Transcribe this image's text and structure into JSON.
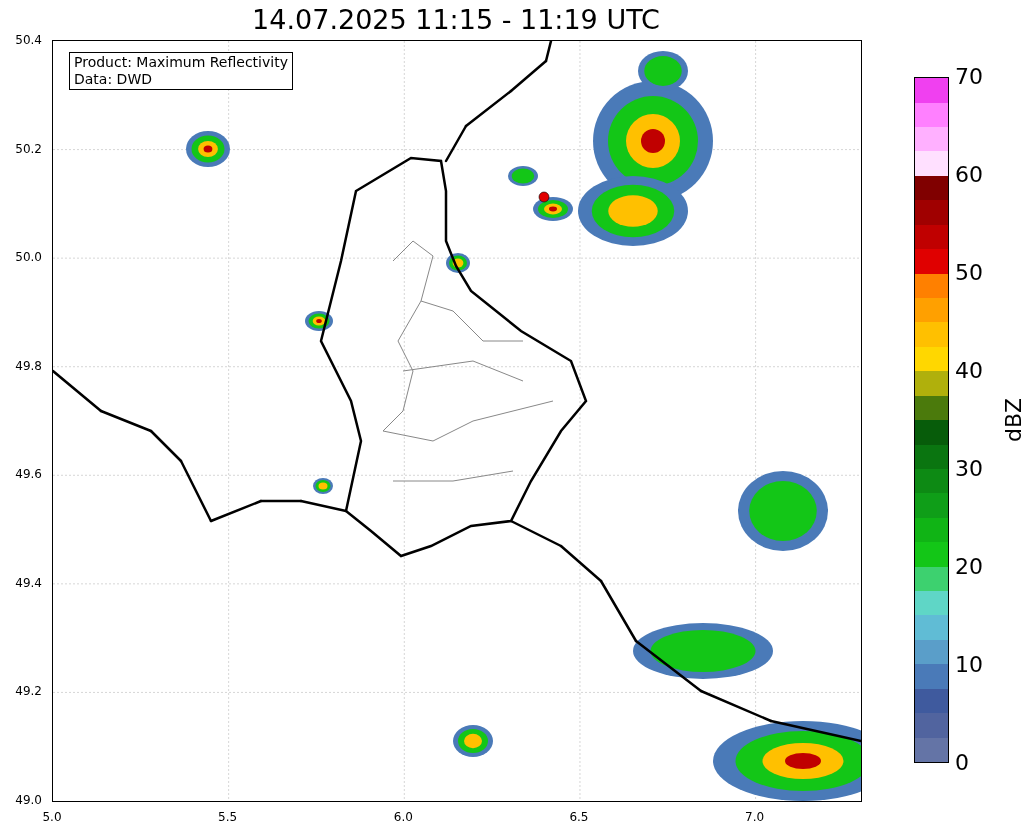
{
  "title": "14.07.2025 11:15 - 11:19 UTC",
  "map": {
    "info_box": [
      "Product: Maximum Reflectivity",
      "Data: DWD"
    ],
    "xticks": [
      "5.0",
      "5.5",
      "6.0",
      "6.5",
      "7.0"
    ],
    "yticks": [
      "50.4",
      "50.2",
      "50.0",
      "49.8",
      "49.6",
      "49.4",
      "49.2",
      "49.0"
    ]
  },
  "colorbar": {
    "label": "dBZ",
    "ticks": [
      "70",
      "60",
      "50",
      "40",
      "30",
      "20",
      "10",
      "0"
    ],
    "segments": [
      {
        "color": "#6474a6"
      },
      {
        "color": "#51649f"
      },
      {
        "color": "#3f5a9e"
      },
      {
        "color": "#4a7ab8"
      },
      {
        "color": "#5a9ec9"
      },
      {
        "color": "#60bcd5"
      },
      {
        "color": "#5fd6c6"
      },
      {
        "color": "#3dd16f"
      },
      {
        "color": "#13c617"
      },
      {
        "color": "#10b415"
      },
      {
        "color": "#0f9e18"
      },
      {
        "color": "#0d8a14"
      },
      {
        "color": "#0a7510"
      },
      {
        "color": "#075c0a"
      },
      {
        "color": "#4b7a0c"
      },
      {
        "color": "#b0b00c"
      },
      {
        "color": "#ffd700"
      },
      {
        "color": "#ffc000"
      },
      {
        "color": "#ffa000"
      },
      {
        "color": "#ff8000"
      },
      {
        "color": "#e00000"
      },
      {
        "color": "#c00000"
      },
      {
        "color": "#a00000"
      },
      {
        "color": "#800000"
      },
      {
        "color": "#ffe0ff"
      },
      {
        "color": "#ffb0ff"
      },
      {
        "color": "#ff80ff"
      },
      {
        "color": "#f040f0"
      }
    ]
  }
}
